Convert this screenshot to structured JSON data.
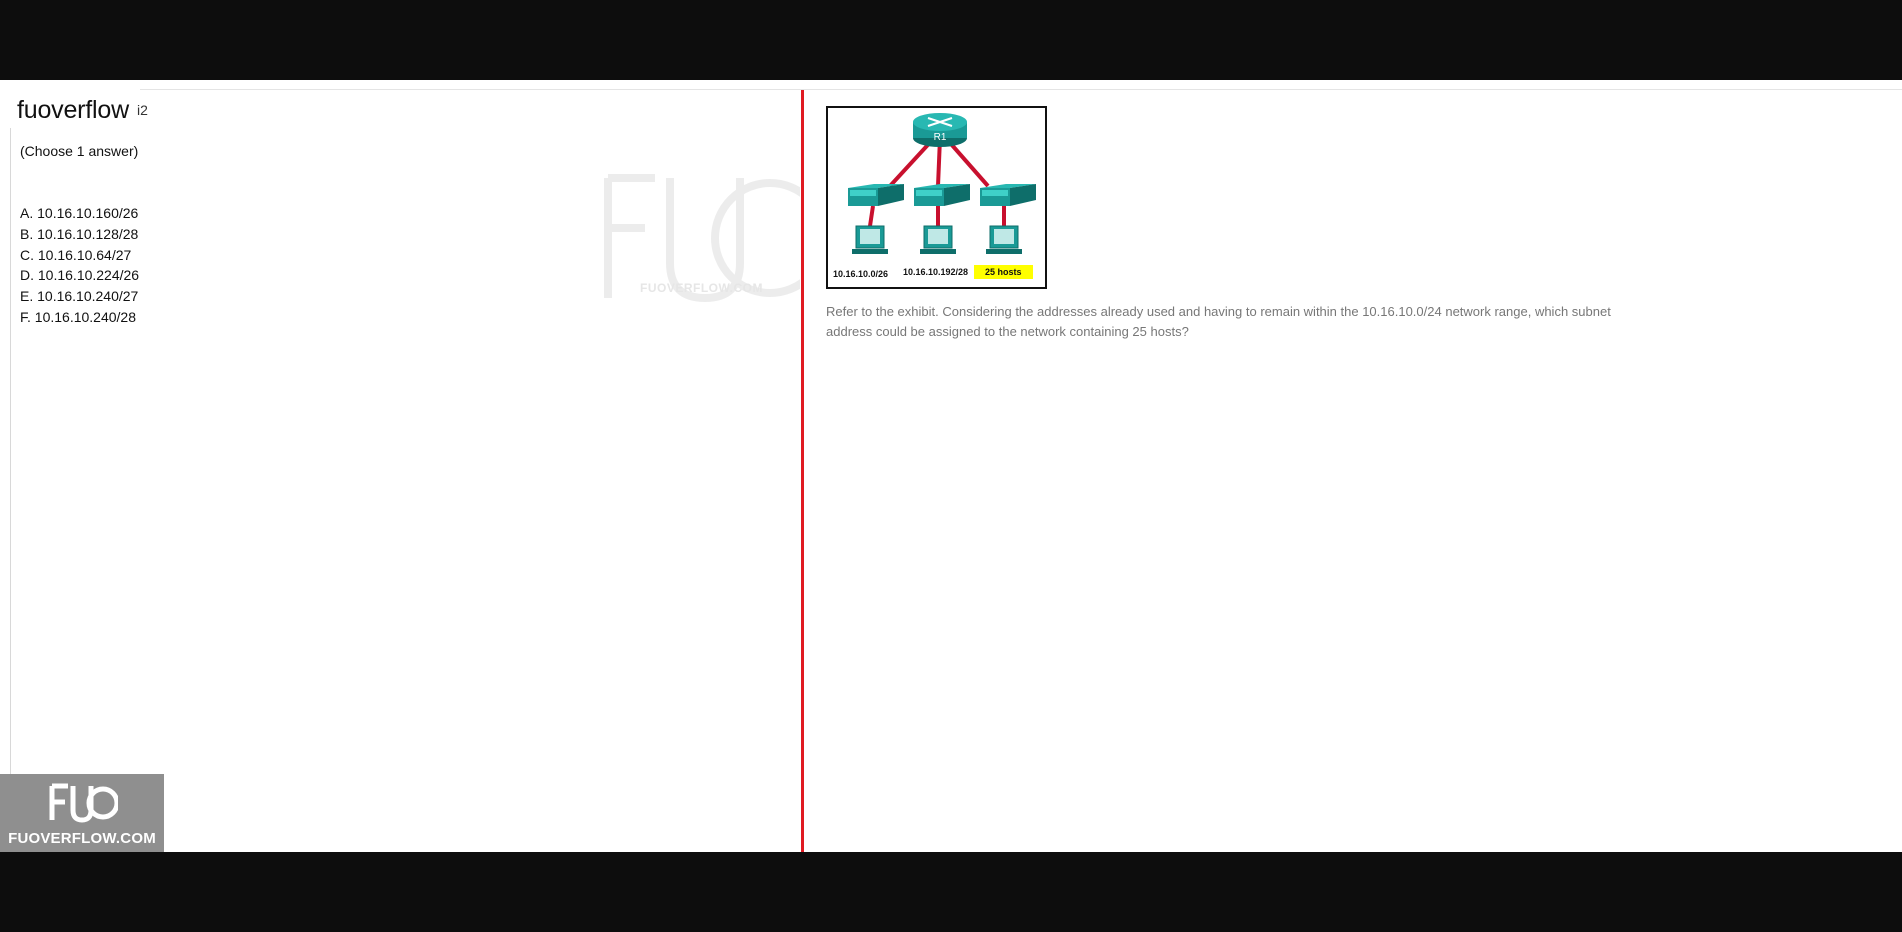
{
  "brand": "fuoverflow",
  "question_number_fragment": "i2",
  "instruction": "(Choose 1 answer)",
  "answers": [
    "A. 10.16.10.160/26",
    "B. 10.16.10.128/28",
    "C. 10.16.10.64/27",
    "D. 10.16.10.224/26",
    "E. 10.16.10.240/27",
    "F. 10.16.10.240/28"
  ],
  "watermark_text": "FUOVERFLOW.COM",
  "exhibit": {
    "router_label": "R1",
    "labels": [
      "10.16.10.0/26",
      "10.16.10.192/28",
      "25 hosts"
    ],
    "highlight_color": "#ffff00",
    "device_color": "#1a9a96",
    "link_color": "#c8102e"
  },
  "question_text": "Refer to the exhibit. Considering the addresses already used and having to remain within the 10.16.10.0/24 network range, which subnet address could be assigned to the network containing 25 hosts?",
  "logo": {
    "glyph": "FUO",
    "text": "FUOVERFLOW.COM"
  },
  "colors": {
    "divider": "#e01a22",
    "logo_bg": "#8f8f8f"
  }
}
